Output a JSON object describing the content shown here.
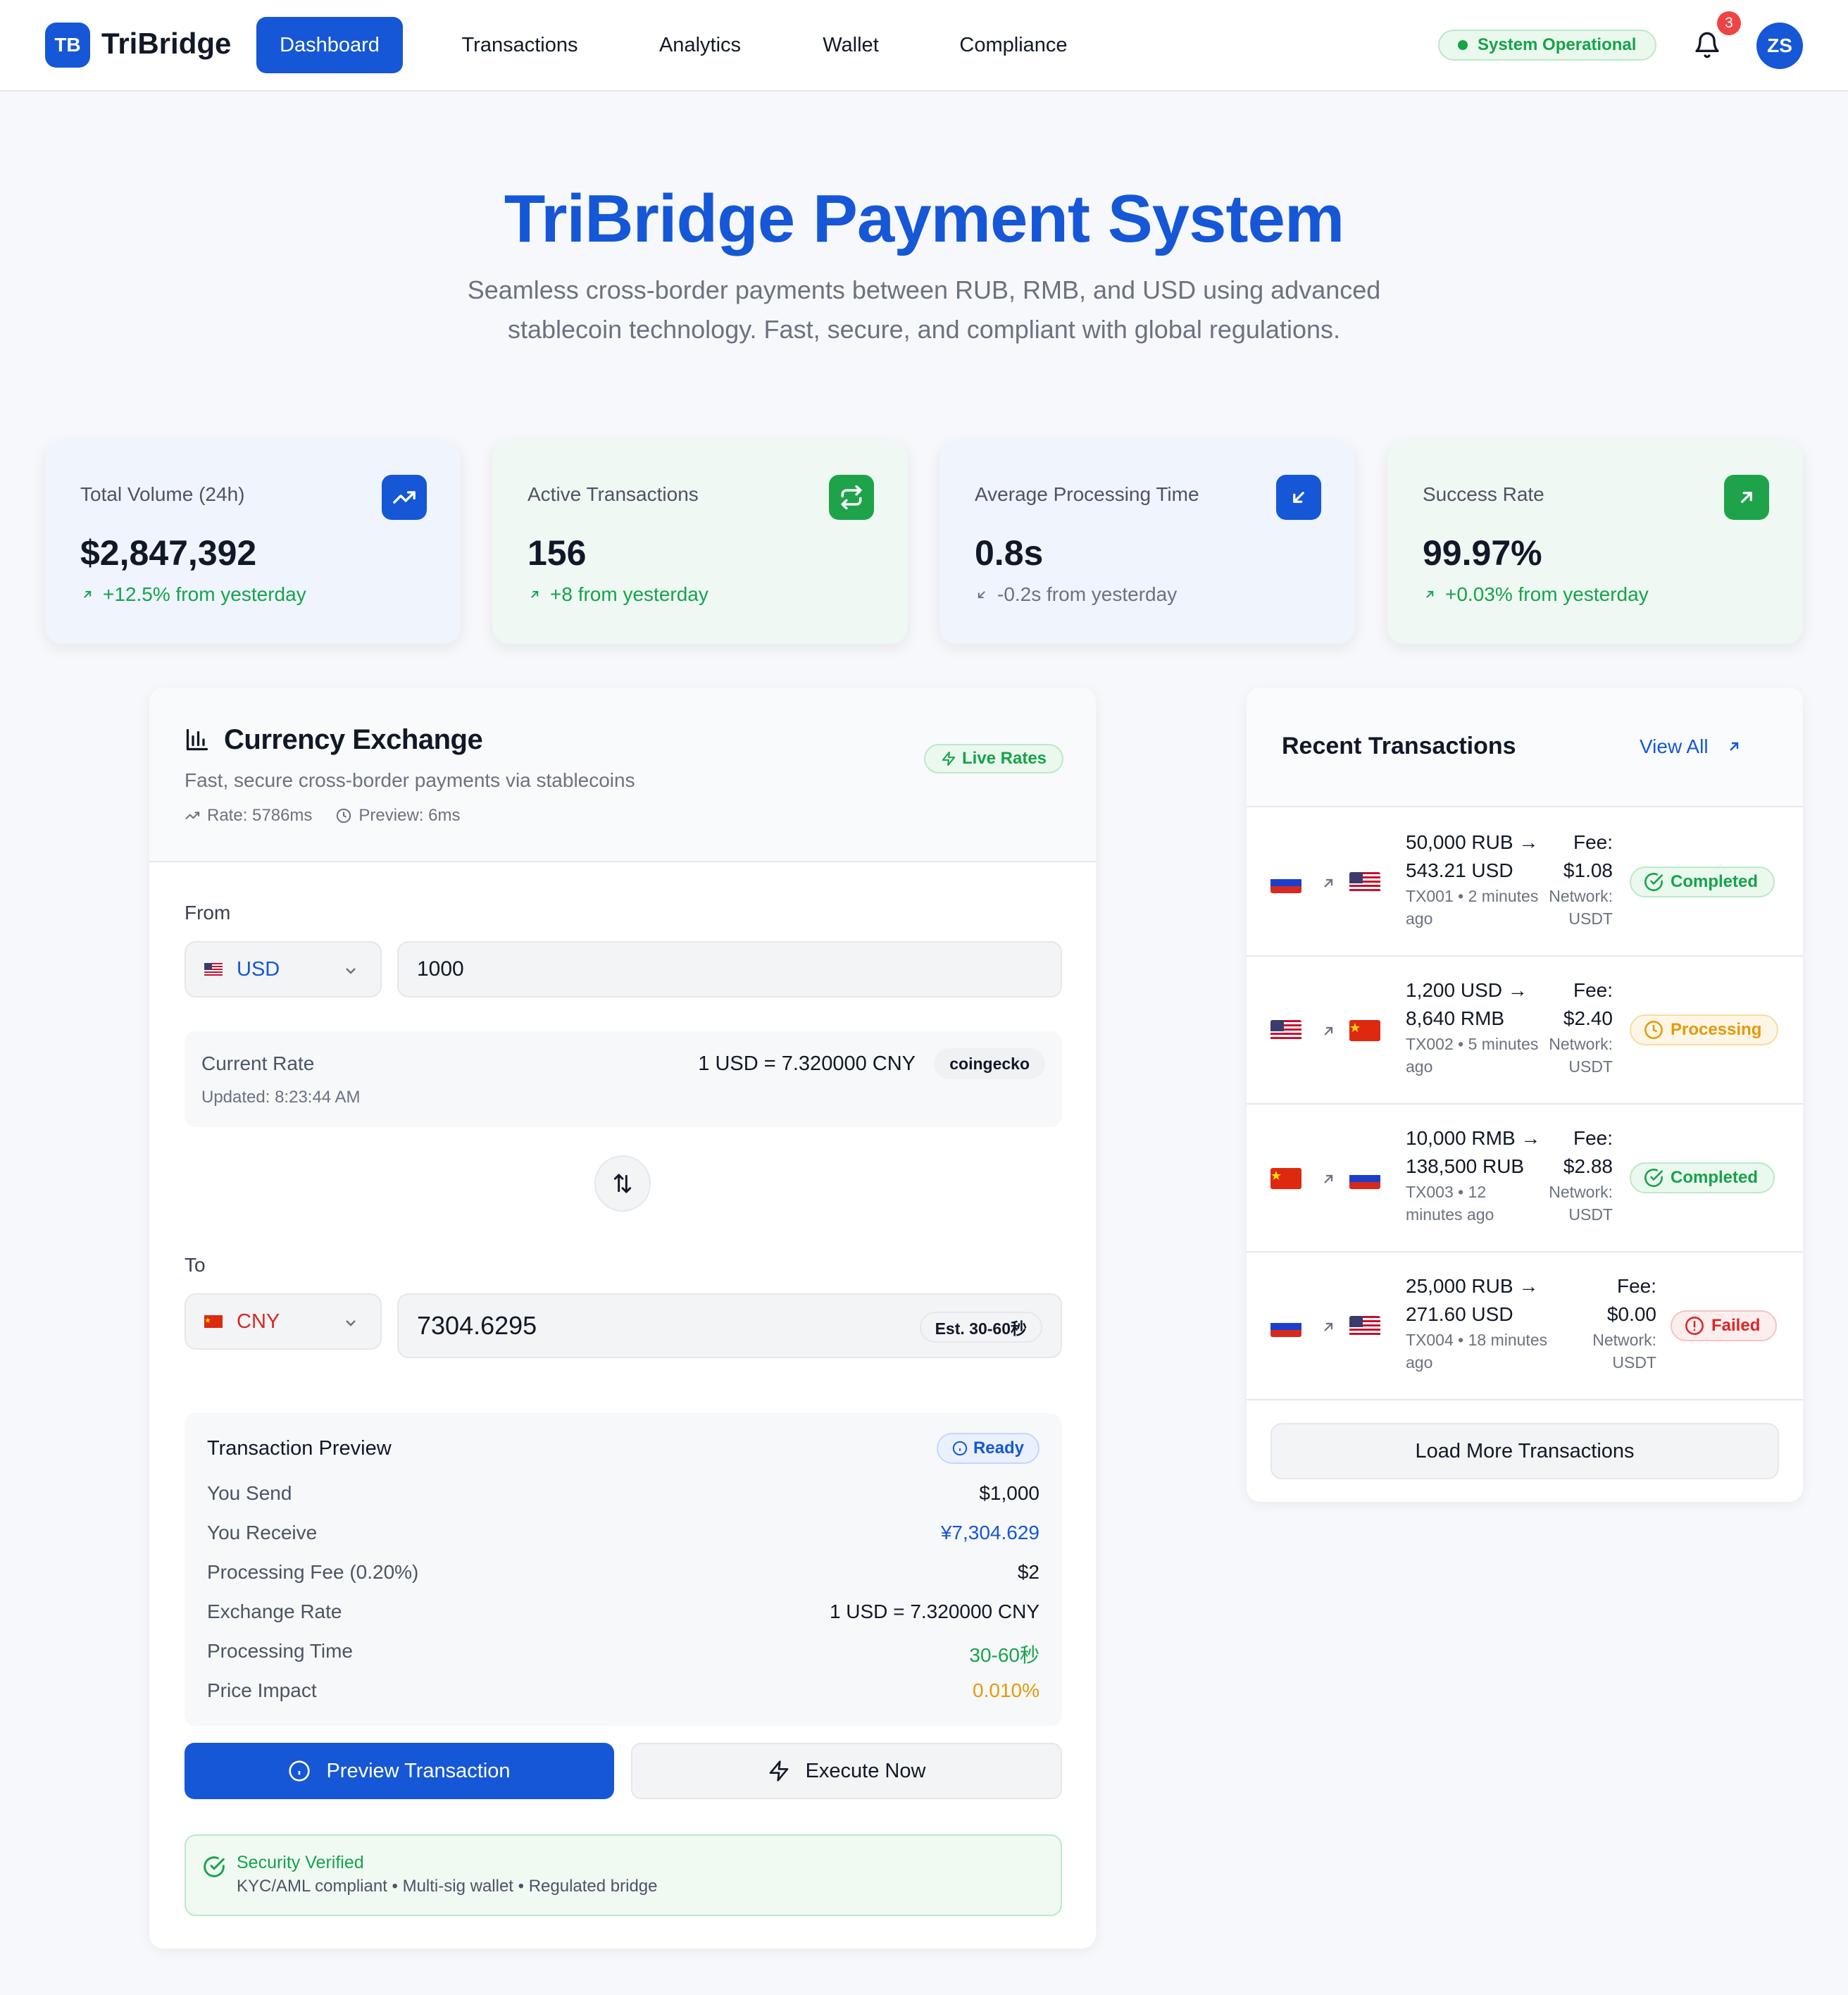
{
  "app": {
    "logo_initials": "TB",
    "name": "TriBridge"
  },
  "nav": {
    "items": [
      {
        "label": "Dashboard",
        "active": true
      },
      {
        "label": "Transactions",
        "active": false
      },
      {
        "label": "Analytics",
        "active": false
      },
      {
        "label": "Wallet",
        "active": false
      },
      {
        "label": "Compliance",
        "active": false
      }
    ],
    "status": "System Operational",
    "notifications_count": "3",
    "user_initials": "ZS"
  },
  "hero": {
    "title": "TriBridge Payment System",
    "subtitle": "Seamless cross-border payments between RUB, RMB, and USD using advanced stablecoin technology. Fast, secure, and compliant with global regulations."
  },
  "stats": [
    {
      "label": "Total Volume (24h)",
      "value": "$2,847,392",
      "delta": "+12.5% from yesterday",
      "icon": "trending-up-icon"
    },
    {
      "label": "Active Transactions",
      "value": "156",
      "delta": "+8 from yesterday",
      "icon": "repeat-icon"
    },
    {
      "label": "Average Processing Time",
      "value": "0.8s",
      "delta": "-0.2s from yesterday",
      "icon": "arrow-down-left-icon"
    },
    {
      "label": "Success Rate",
      "value": "99.97%",
      "delta": "+0.03% from yesterday",
      "icon": "arrow-up-right-icon"
    }
  ],
  "exchange": {
    "title": "Currency Exchange",
    "subtitle": "Fast, secure cross-border payments via stablecoins",
    "rate_timing": "Rate: 5786ms",
    "preview_timing": "Preview: 6ms",
    "live_label": "Live Rates",
    "from_label": "From",
    "from_currency": "USD",
    "from_amount": "1000",
    "rate_label": "Current Rate",
    "rate_value": "1 USD = 7.320000 CNY",
    "rate_source": "coingecko",
    "rate_updated": "Updated: 8:23:44 AM",
    "to_label": "To",
    "to_currency": "CNY",
    "to_amount": "7304.6295",
    "to_estimate": "Est. 30-60秒",
    "preview": {
      "title": "Transaction Preview",
      "status": "Ready",
      "rows": [
        {
          "label": "You Send",
          "value": "$1,000"
        },
        {
          "label": "You Receive",
          "value": "¥7,304.629"
        },
        {
          "label": "Processing Fee (0.20%)",
          "value": "$2"
        },
        {
          "label": "Exchange Rate",
          "value": "1 USD = 7.320000 CNY"
        },
        {
          "label": "Processing Time",
          "value": "30-60秒"
        },
        {
          "label": "Price Impact",
          "value": "0.010%"
        }
      ]
    },
    "preview_button": "Preview Transaction",
    "execute_button": "Execute Now",
    "security_title": "Security Verified",
    "security_detail": "KYC/AML compliant • Multi-sig wallet • Regulated bridge"
  },
  "recent": {
    "title": "Recent Transactions",
    "view_all": "View All",
    "transactions": [
      {
        "from_flag": "ru",
        "to_flag": "us",
        "line1": "50,000 RUB →",
        "line2": "543.21 USD",
        "meta": "TX001 • 2 minutes ago",
        "fee_label": "Fee:",
        "fee": "$1.08",
        "network": "Network: USDT",
        "status": "Completed"
      },
      {
        "from_flag": "us",
        "to_flag": "cn",
        "line1": "1,200 USD →",
        "line2": "8,640 RMB",
        "meta": "TX002 • 5 minutes ago",
        "fee_label": "Fee:",
        "fee": "$2.40",
        "network": "Network: USDT",
        "status": "Processing"
      },
      {
        "from_flag": "cn",
        "to_flag": "ru",
        "line1": "10,000 RMB →",
        "line2": "138,500 RUB",
        "meta": "TX003 • 12 minutes ago",
        "fee_label": "Fee:",
        "fee": "$2.88",
        "network": "Network: USDT",
        "status": "Completed"
      },
      {
        "from_flag": "ru",
        "to_flag": "us",
        "line1": "25,000 RUB →",
        "line2": "271.60 USD",
        "meta": "TX004 • 18 minutes ago",
        "fee_label": "Fee:",
        "fee": "$0.00",
        "network": "Network: USDT",
        "status": "Failed"
      }
    ],
    "load_more": "Load More Transactions"
  },
  "colors": {
    "primary": "#1557d6",
    "success": "#16a34a",
    "warning": "#e49a0b",
    "danger": "#dc2626"
  }
}
